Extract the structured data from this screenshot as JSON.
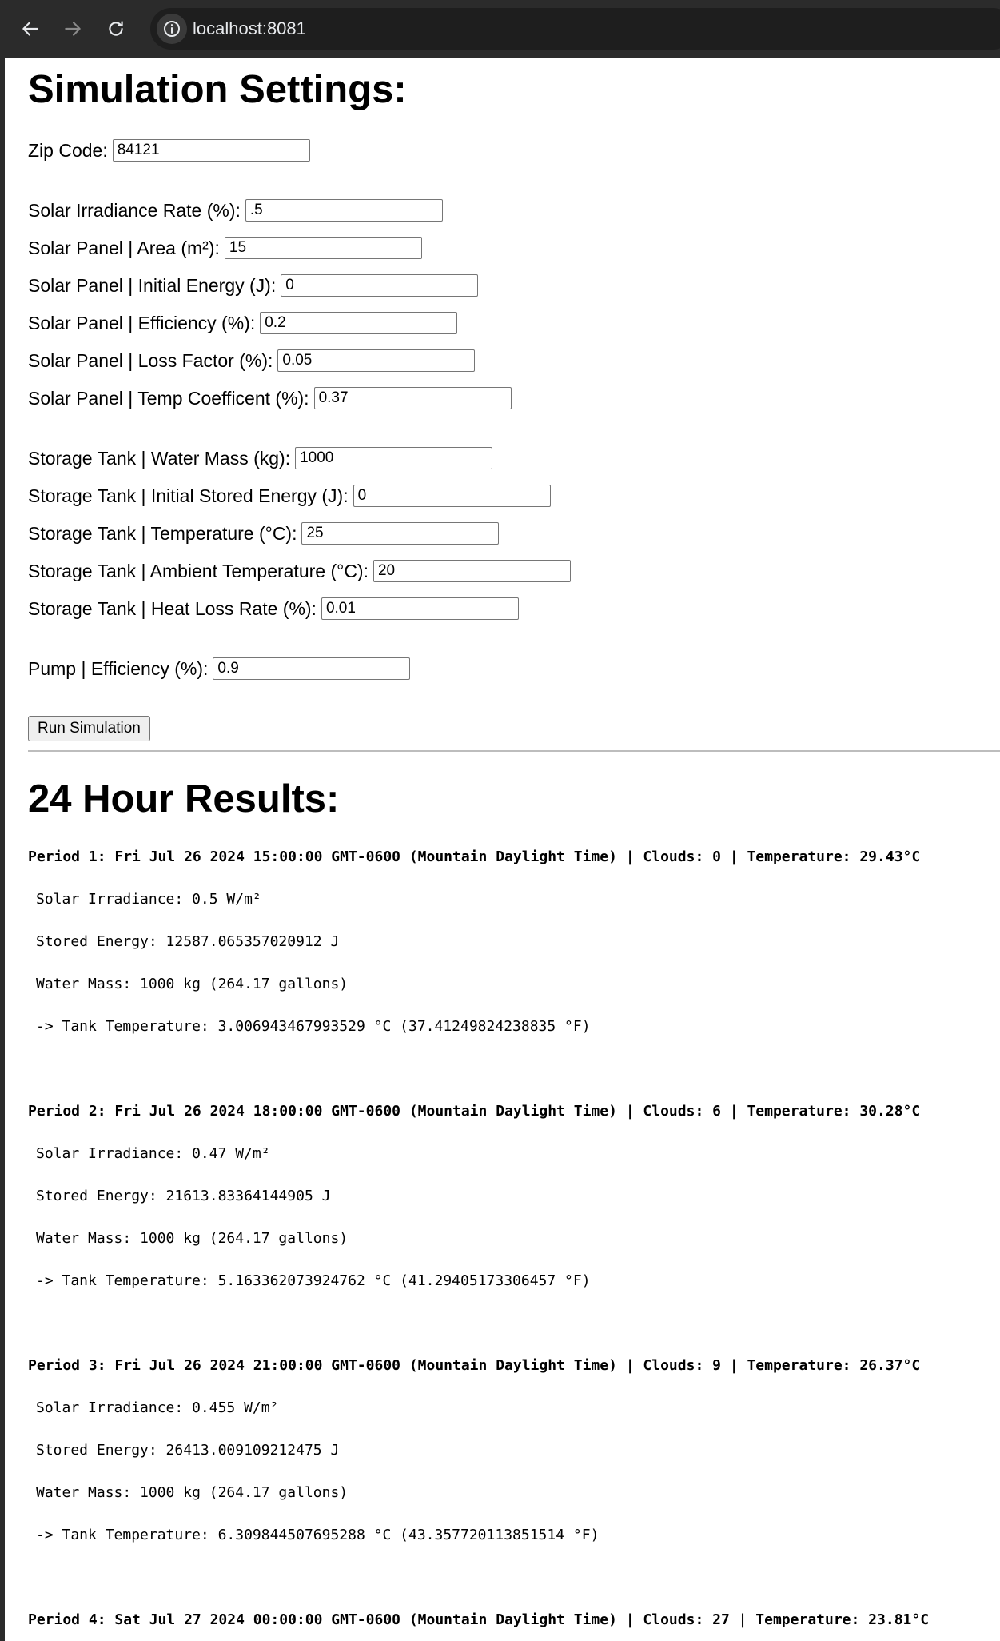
{
  "browser": {
    "url": "localhost:8081"
  },
  "settings": {
    "title": "Simulation Settings:",
    "zip": {
      "label": "Zip Code:",
      "value": "84121"
    },
    "solar_irradiance": {
      "label": "Solar Irradiance Rate (%):",
      "value": ".5"
    },
    "panel_area": {
      "label": "Solar Panel | Area (m²):",
      "value": "15"
    },
    "panel_initial_energy": {
      "label": "Solar Panel | Initial Energy (J):",
      "value": "0"
    },
    "panel_efficiency": {
      "label": "Solar Panel | Efficiency (%):",
      "value": "0.2"
    },
    "panel_loss_factor": {
      "label": "Solar Panel | Loss Factor (%):",
      "value": "0.05"
    },
    "panel_temp_coefficient": {
      "label": "Solar Panel | Temp Coefficent (%):",
      "value": "0.37"
    },
    "tank_water_mass": {
      "label": "Storage Tank | Water Mass (kg):",
      "value": "1000"
    },
    "tank_initial_energy": {
      "label": "Storage Tank | Initial Stored Energy (J):",
      "value": "0"
    },
    "tank_temperature": {
      "label": "Storage Tank | Temperature (°C):",
      "value": "25"
    },
    "tank_ambient_temperature": {
      "label": "Storage Tank | Ambient Temperature (°C):",
      "value": "20"
    },
    "tank_heat_loss_rate": {
      "label": "Storage Tank | Heat Loss Rate (%):",
      "value": "0.01"
    },
    "pump_efficiency": {
      "label": "Pump | Efficiency (%):",
      "value": "0.9"
    },
    "run_button": "Run Simulation"
  },
  "results": {
    "title": "24 Hour Results:",
    "periods": [
      {
        "header": "Period 1: Fri Jul 26 2024 15:00:00 GMT-0600 (Mountain Daylight Time) | Clouds: 0 | Temperature: 29.43°C",
        "irradiance": "Solar Irradiance: 0.5 W/m²",
        "stored_energy": "Stored Energy: 12587.065357020912 J",
        "water_mass": "Water Mass: 1000 kg (264.17 gallons)",
        "tank_temperature": "-> Tank Temperature: 3.006943467993529 °C (37.41249824238835 °F)"
      },
      {
        "header": "Period 2: Fri Jul 26 2024 18:00:00 GMT-0600 (Mountain Daylight Time) | Clouds: 6 | Temperature: 30.28°C",
        "irradiance": "Solar Irradiance: 0.47 W/m²",
        "stored_energy": "Stored Energy: 21613.83364144905 J",
        "water_mass": "Water Mass: 1000 kg (264.17 gallons)",
        "tank_temperature": "-> Tank Temperature: 5.163362073924762 °C (41.29405173306457 °F)"
      },
      {
        "header": "Period 3: Fri Jul 26 2024 21:00:00 GMT-0600 (Mountain Daylight Time) | Clouds: 9 | Temperature: 26.37°C",
        "irradiance": "Solar Irradiance: 0.455 W/m²",
        "stored_energy": "Stored Energy: 26413.009109212475 J",
        "water_mass": "Water Mass: 1000 kg (264.17 gallons)",
        "tank_temperature": "-> Tank Temperature: 6.309844507695288 °C (43.357720113851514 °F)"
      },
      {
        "header": "Period 4: Sat Jul 27 2024 00:00:00 GMT-0600 (Mountain Daylight Time) | Clouds: 27 | Temperature: 23.81°C"
      }
    ]
  }
}
